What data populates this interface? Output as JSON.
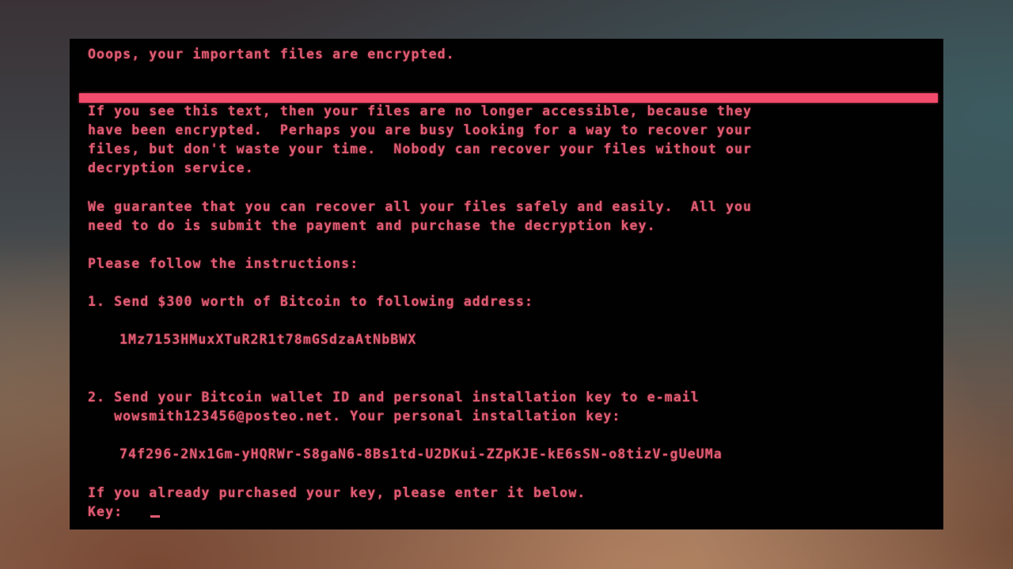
{
  "title": "Ooops, your important files are encrypted.",
  "colors": {
    "screen_background": "#020101",
    "text": "#e05c72",
    "divider": "#f34b6c"
  },
  "intro_paragraph": [
    "If you see this text, then your files are no longer accessible, because they",
    "have been encrypted.  Perhaps you are busy looking for a way to recover your",
    "files, but don't waste your time.  Nobody can recover your files without our",
    "decryption service."
  ],
  "guarantee_paragraph": [
    "We guarantee that you can recover all your files safely and easily.  All you",
    "need to do is submit the payment and purchase the decryption key."
  ],
  "instructions_heading": "Please follow the instructions:",
  "step1": {
    "text": "1. Send $300 worth of Bitcoin to following address:",
    "bitcoin_address": "1Mz7153HMuxXTuR2R1t78mGSdzaAtNbBWX"
  },
  "step2": {
    "lines": [
      "2. Send your Bitcoin wallet ID and personal installation key to e-mail",
      "   wowsmith123456@posteo.net. Your personal installation key:"
    ],
    "installation_key": "74f296-2Nx1Gm-yHQRWr-S8gaN6-8Bs1td-U2DKui-ZZpKJE-kE6sSN-o8tizV-gUeUMa"
  },
  "key_prompt": {
    "text": "If you already purchased your key, please enter it below.",
    "label": "Key:",
    "value": ""
  }
}
